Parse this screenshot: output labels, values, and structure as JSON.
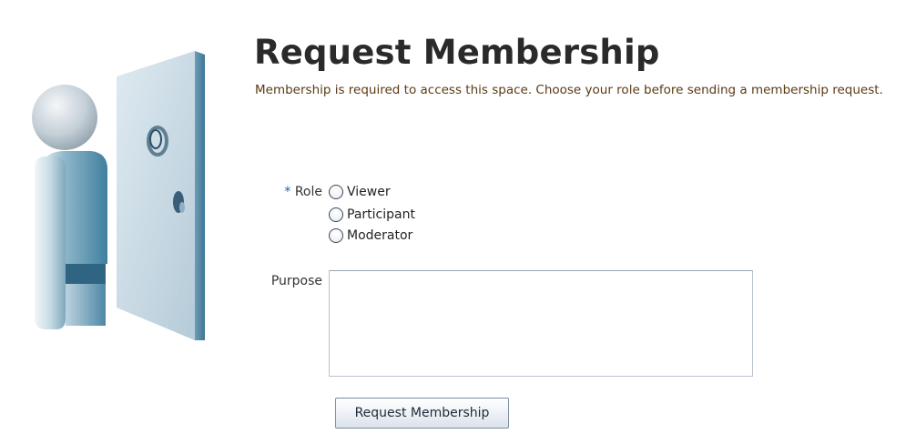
{
  "page": {
    "title": "Request Membership",
    "description": "Membership is required to access this space. Choose your role before sending a membership request."
  },
  "illustration": {
    "icon": "person-at-door-icon"
  },
  "form": {
    "role": {
      "required_marker": "*",
      "label": "Role",
      "options": [
        "Viewer",
        "Participant",
        "Moderator"
      ],
      "selected": null
    },
    "purpose": {
      "label": "Purpose",
      "value": ""
    },
    "submit_label": "Request Membership"
  },
  "colors": {
    "title": "#2a2a2a",
    "description": "#5a3a14",
    "required_marker": "#1a5fa8",
    "figure_body": "#4f8fab",
    "door": "#c9dbe6"
  }
}
